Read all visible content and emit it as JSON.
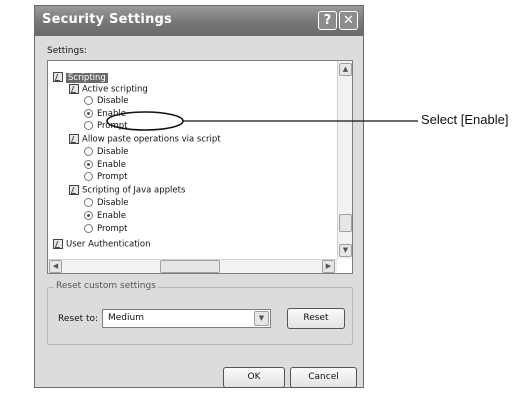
{
  "window": {
    "title": "Security Settings",
    "help_label": "?",
    "close_label": "✕"
  },
  "settings_label": "Settings:",
  "tree": {
    "root": "Scripting",
    "active_scripting": "Active scripting",
    "active_disable": "Disable",
    "active_enable": "Enable",
    "active_prompt": "Prompt",
    "paste": "Allow paste operations via script",
    "paste_disable": "Disable",
    "paste_enable": "Enable",
    "paste_prompt": "Prompt",
    "java": "Scripting of Java applets",
    "java_disable": "Disable",
    "java_enable": "Enable",
    "java_prompt": "Prompt",
    "user_auth": "User Authentication"
  },
  "reset_group": {
    "legend": "Reset custom settings",
    "reset_to_label": "Reset to:",
    "selected": "Medium",
    "reset_button": "Reset"
  },
  "buttons": {
    "ok": "OK",
    "cancel": "Cancel"
  },
  "callout": {
    "text": "Select [Enable]"
  }
}
